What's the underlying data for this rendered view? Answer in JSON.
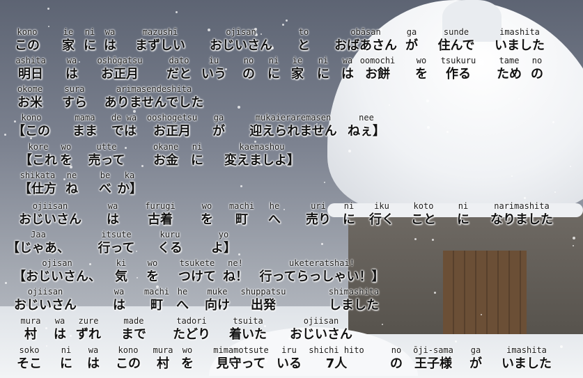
{
  "lines": [
    {
      "tokens": [
        {
          "romaji": "kono",
          "jp": "この"
        },
        {
          "romaji": "ie",
          "jp": "家"
        },
        {
          "romaji": "ni",
          "jp": "に"
        },
        {
          "romaji": "wa",
          "jp": "は"
        },
        {
          "romaji": "mazushī",
          "jp": "まずしい"
        },
        {
          "romaji": "ojīsan",
          "jp": "おじいさん"
        },
        {
          "romaji": "to",
          "jp": "と"
        },
        {
          "romaji": "obāsan",
          "jp": "おばあさん"
        },
        {
          "romaji": "ga",
          "jp": "が"
        },
        {
          "romaji": "sunde",
          "jp": "住んで"
        },
        {
          "romaji": "imashita",
          "jp": "いました"
        }
      ]
    },
    {
      "tokens": [
        {
          "romaji": "ashita",
          "jp": "明日"
        },
        {
          "romaji": "wa",
          "jp": "は"
        },
        {
          "romaji": "oshōgatsu",
          "jp": "お正月"
        },
        {
          "romaji": "dato",
          "jp": "だと"
        },
        {
          "romaji": "iu",
          "jp": "いう"
        },
        {
          "romaji": "no",
          "jp": "の"
        },
        {
          "romaji": "ni",
          "jp": "に"
        },
        {
          "romaji": "ie",
          "jp": "家"
        },
        {
          "romaji": "ni",
          "jp": "に"
        },
        {
          "romaji": "wa",
          "jp": "は"
        },
        {
          "romaji": "oomochi",
          "jp": "お餅"
        },
        {
          "romaji": "wo",
          "jp": "を"
        },
        {
          "romaji": "tsukuru",
          "jp": "作る"
        },
        {
          "romaji": "tame",
          "jp": "ため"
        },
        {
          "romaji": "no",
          "jp": "の"
        }
      ]
    },
    {
      "tokens": [
        {
          "romaji": "okome",
          "jp": "お米"
        },
        {
          "romaji": "sura",
          "jp": "すら"
        },
        {
          "romaji": "arimasendeshita",
          "jp": "ありませんでした"
        }
      ]
    },
    {
      "tokens": [
        {
          "romaji": "kono",
          "jp": "【この"
        },
        {
          "romaji": "mama",
          "jp": "まま"
        },
        {
          "romaji": "de wa",
          "jp": "では"
        },
        {
          "romaji": "ooshogetsu",
          "jp": "お正月"
        },
        {
          "romaji": "ga",
          "jp": "が"
        },
        {
          "romaji": "mukaieraremasen",
          "jp": "迎えられません"
        },
        {
          "romaji": "nee",
          "jp": "ねぇ】"
        }
      ]
    },
    {
      "tokens": [
        {
          "romaji": "kore",
          "jp": "【これ"
        },
        {
          "romaji": "wo",
          "jp": "を"
        },
        {
          "romaji": "utte",
          "jp": "売って"
        },
        {
          "romaji": "okane",
          "jp": "お金"
        },
        {
          "romaji": "ni",
          "jp": "に"
        },
        {
          "romaji": "kaemashou",
          "jp": "変えましよ】"
        }
      ]
    },
    {
      "tokens": [
        {
          "romaji": "shikata",
          "jp": "【仕方"
        },
        {
          "romaji": "ne",
          "jp": "ね"
        },
        {
          "romaji": "be",
          "jp": "べ"
        },
        {
          "romaji": "ka",
          "jp": "か】"
        }
      ]
    },
    {
      "tokens": [
        {
          "romaji": "ojiisan",
          "jp": "おじいさん"
        },
        {
          "romaji": "wa",
          "jp": "は"
        },
        {
          "romaji": "furugi",
          "jp": "古着"
        },
        {
          "romaji": "wo",
          "jp": "を"
        },
        {
          "romaji": "machi",
          "jp": "町"
        },
        {
          "romaji": "he",
          "jp": "へ"
        },
        {
          "romaji": "uri",
          "jp": "売り"
        },
        {
          "romaji": "ni",
          "jp": "に"
        },
        {
          "romaji": "iku",
          "jp": "行く"
        },
        {
          "romaji": "koto",
          "jp": "こと"
        },
        {
          "romaji": "ni",
          "jp": "に"
        },
        {
          "romaji": "narimashita",
          "jp": "なりました"
        }
      ]
    },
    {
      "tokens": [
        {
          "romaji": "Jaa",
          "jp": "【じゃあ、"
        },
        {
          "romaji": "itsute",
          "jp": "行って"
        },
        {
          "romaji": "kuru",
          "jp": "くる"
        },
        {
          "romaji": "yo",
          "jp": "よ】"
        }
      ]
    },
    {
      "tokens": [
        {
          "romaji": "ojisan",
          "jp": "【おじいさん、"
        },
        {
          "romaji": "ki",
          "jp": "気"
        },
        {
          "romaji": "wo",
          "jp": "を"
        },
        {
          "romaji": "tsukete",
          "jp": "つけて"
        },
        {
          "romaji": "ne!",
          "jp": "ね！"
        },
        {
          "romaji": "uketeratshai!",
          "jp": "行ってらっしゃい！】"
        }
      ]
    },
    {
      "tokens": [
        {
          "romaji": "ojiisan",
          "jp": "おじいさん"
        },
        {
          "romaji": "wa",
          "jp": "は"
        },
        {
          "romaji": "machi",
          "jp": "町"
        },
        {
          "romaji": "he",
          "jp": "へ"
        },
        {
          "romaji": "muke",
          "jp": "向け"
        },
        {
          "romaji": "shuppatsu",
          "jp": "出発"
        },
        {
          "romaji": "shimashita",
          "jp": "しました"
        }
      ]
    },
    {
      "tokens": [
        {
          "romaji": "mura",
          "jp": "村"
        },
        {
          "romaji": "wa",
          "jp": "は"
        },
        {
          "romaji": "zure",
          "jp": "ずれ"
        },
        {
          "romaji": "made",
          "jp": "まで"
        },
        {
          "romaji": "tadori",
          "jp": "たどり"
        },
        {
          "romaji": "tsuita",
          "jp": "着いた"
        },
        {
          "romaji": "ojiisan",
          "jp": "おじいさん"
        }
      ]
    },
    {
      "tokens": [
        {
          "romaji": "soko",
          "jp": "そこ"
        },
        {
          "romaji": "ni",
          "jp": "に"
        },
        {
          "romaji": "wa",
          "jp": "は"
        },
        {
          "romaji": "kono",
          "jp": "この"
        },
        {
          "romaji": "mura",
          "jp": "村"
        },
        {
          "romaji": "wo",
          "jp": "を"
        },
        {
          "romaji": "mimamotsute",
          "jp": "見守って"
        },
        {
          "romaji": "iru",
          "jp": "いる"
        },
        {
          "romaji": "shichi hito",
          "jp": "7人"
        },
        {
          "romaji": "no",
          "jp": "の"
        },
        {
          "romaji": "ōji-sama",
          "jp": "王子様"
        },
        {
          "romaji": "ga",
          "jp": "が"
        },
        {
          "romaji": "imashita",
          "jp": "いました"
        }
      ]
    }
  ]
}
